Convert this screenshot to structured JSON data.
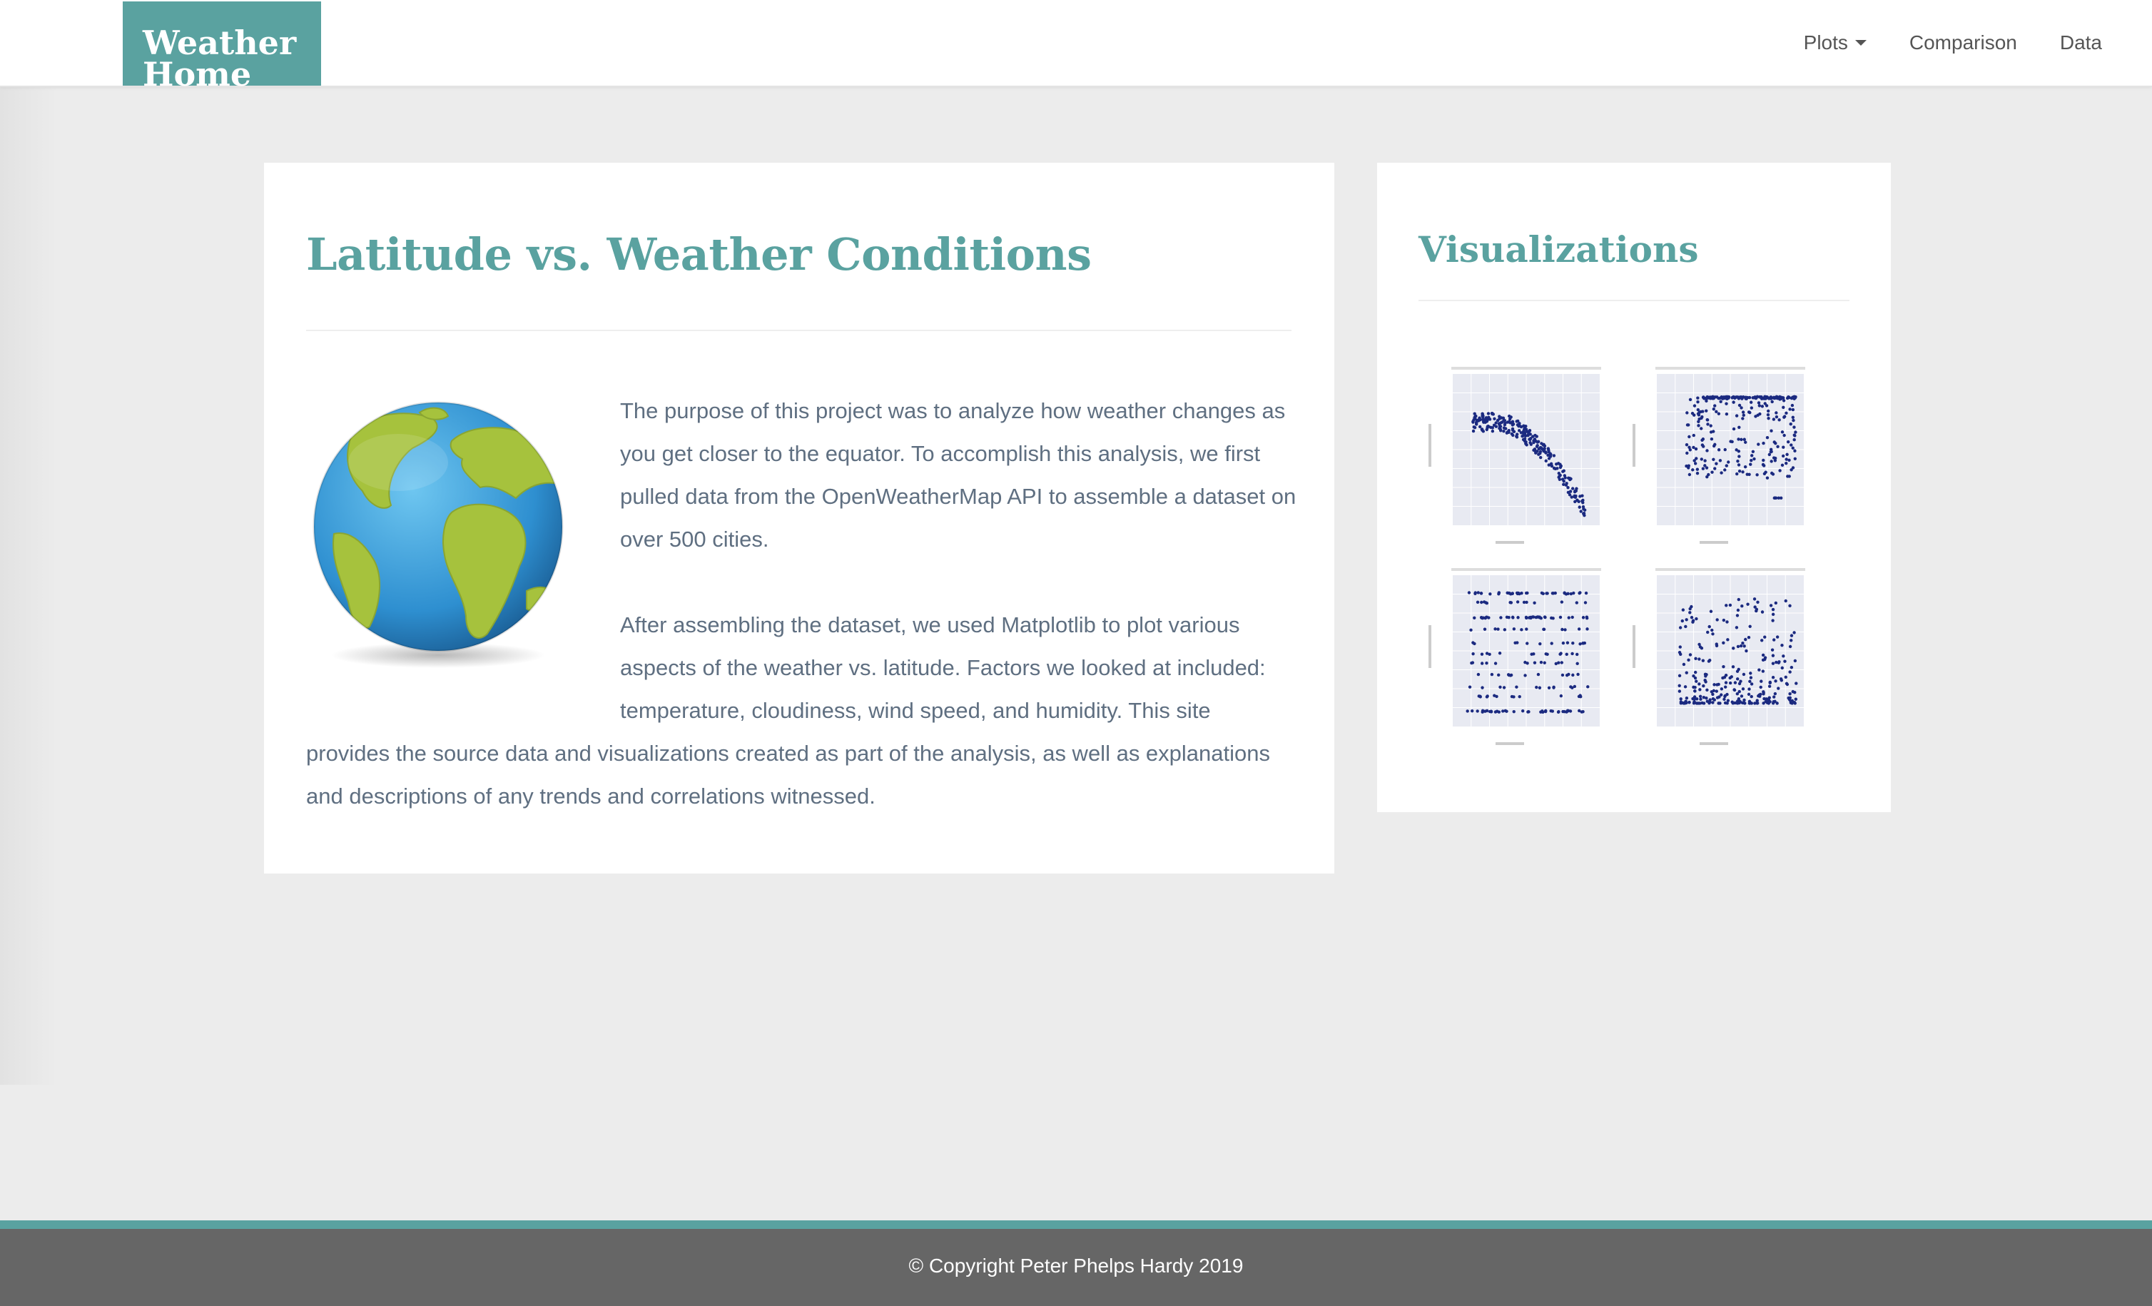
{
  "nav": {
    "brand_line1": "Weather",
    "brand_line2": "Home",
    "links": [
      {
        "label": "Plots"
      },
      {
        "label": "Comparison"
      },
      {
        "label": "Data"
      }
    ]
  },
  "main": {
    "title": "Latitude vs. Weather Conditions",
    "paragraph1": "The purpose of this project was to analyze how weather changes as you get closer to the equator. To accomplish this analysis, we first pulled data from the OpenWeatherMap API to assemble a dataset on over 500 cities.",
    "paragraph2": "After assembling the dataset, we used Matplotlib to plot various aspects of the weather vs. latitude. Factors we looked at included: temperature, cloudiness, wind speed, and humidity. This site provides the source data and visualizations created as part of the analysis, as well as explanations and descriptions of any trends and correlations witnessed."
  },
  "visualizations": {
    "title": "Visualizations",
    "thumbnails": [
      {
        "kind": "temperature"
      },
      {
        "kind": "humidity"
      },
      {
        "kind": "cloudiness"
      },
      {
        "kind": "wind"
      }
    ]
  },
  "footer": {
    "text": "© Copyright Peter Phelps Hardy 2019"
  },
  "colors": {
    "accent": "#5aa2a0",
    "footer_bg": "#666666",
    "page_bg": "#ececec",
    "body_text": "#5f6f81"
  }
}
